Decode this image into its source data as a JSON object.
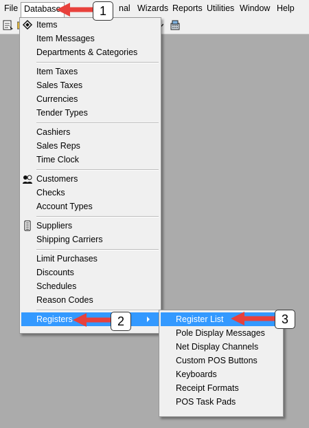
{
  "menubar": {
    "items": [
      {
        "label": "File"
      },
      {
        "label": "Database"
      },
      {
        "label": "nal"
      },
      {
        "label": "Wizards"
      },
      {
        "label": "Reports"
      },
      {
        "label": "Utilities"
      },
      {
        "label": "Window"
      },
      {
        "label": "Help"
      }
    ]
  },
  "toolbar": {
    "icons": [
      "document-icon",
      "partial-icon",
      "dropdown-partial-icon",
      "pos-register-icon"
    ]
  },
  "database_menu": {
    "groups": [
      [
        {
          "label": "Items",
          "icon": "items-icon"
        },
        {
          "label": "Item Messages"
        },
        {
          "label": "Departments & Categories"
        }
      ],
      [
        {
          "label": "Item Taxes"
        },
        {
          "label": "Sales Taxes"
        },
        {
          "label": "Currencies"
        },
        {
          "label": "Tender Types"
        }
      ],
      [
        {
          "label": "Cashiers"
        },
        {
          "label": "Sales Reps"
        },
        {
          "label": "Time Clock"
        }
      ],
      [
        {
          "label": "Customers",
          "icon": "customers-icon"
        },
        {
          "label": "Checks"
        },
        {
          "label": "Account Types"
        }
      ],
      [
        {
          "label": "Suppliers",
          "icon": "suppliers-icon"
        },
        {
          "label": "Shipping Carriers"
        }
      ],
      [
        {
          "label": "Limit Purchases"
        },
        {
          "label": "Discounts"
        },
        {
          "label": "Schedules"
        },
        {
          "label": "Reason Codes"
        }
      ],
      [
        {
          "label": "Registers",
          "highlighted": true,
          "has_submenu": true
        }
      ]
    ]
  },
  "registers_submenu": {
    "items": [
      {
        "label": "Register List",
        "selected": true
      },
      {
        "label": "Pole Display Messages"
      },
      {
        "label": "Net Display Channels"
      },
      {
        "label": "Custom POS Buttons"
      },
      {
        "label": "Keyboards"
      },
      {
        "label": "Receipt Formats"
      },
      {
        "label": "POS Task Pads"
      }
    ]
  },
  "annotations": {
    "step1": "1",
    "step2": "2",
    "step3": "3",
    "arrow_color": "#e8413c"
  },
  "colors": {
    "highlight": "#3399ff",
    "menu_bg": "#f0f0f0",
    "desktop": "#ababab"
  }
}
